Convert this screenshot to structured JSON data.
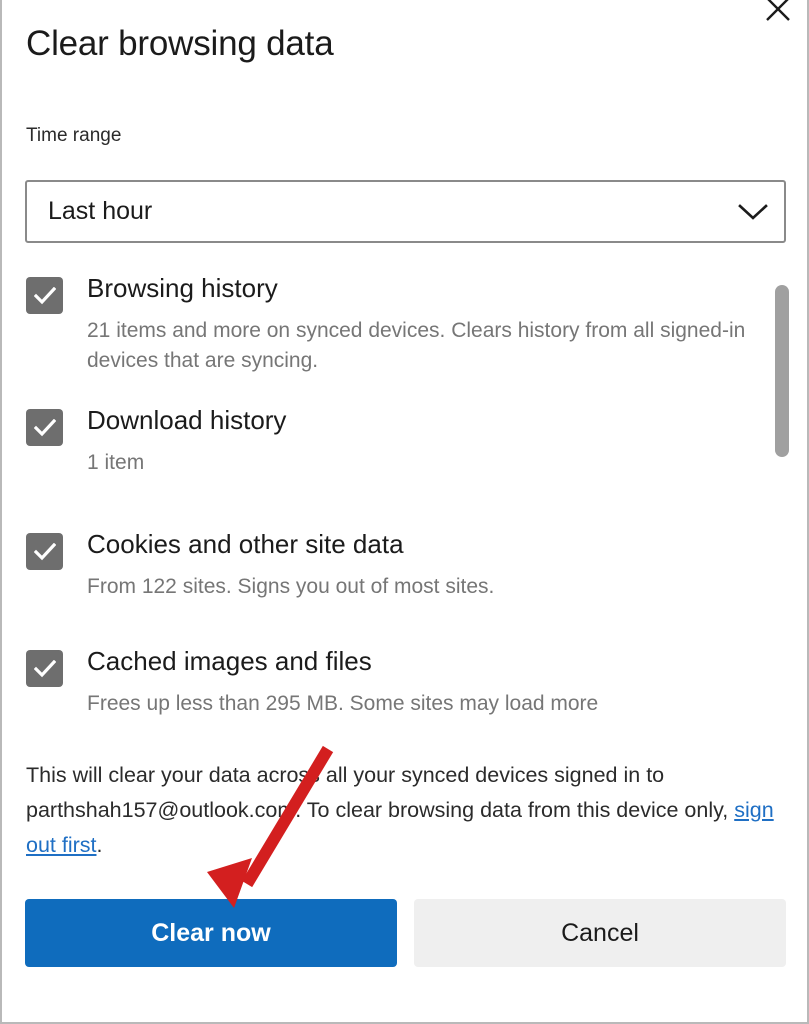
{
  "dialog": {
    "title": "Clear browsing data",
    "close_icon": "close-icon"
  },
  "time_range": {
    "label": "Time range",
    "selected": "Last hour",
    "chevron_icon": "chevron-down-icon"
  },
  "options": [
    {
      "id": "browsing-history",
      "label": "Browsing history",
      "description": "21 items and more on synced devices. Clears history from all signed-in devices that are syncing.",
      "checked": true
    },
    {
      "id": "download-history",
      "label": "Download history",
      "description": "1 item",
      "checked": true
    },
    {
      "id": "cookies-and-other-site-data",
      "label": "Cookies and other site data",
      "description": "From 122 sites. Signs you out of most sites.",
      "checked": true
    },
    {
      "id": "cached-images-and-files",
      "label": "Cached images and files",
      "description": "Frees up less than 295 MB. Some sites may load more",
      "checked": true
    }
  ],
  "footer": {
    "text_before_link": "This will clear your data across all your synced devices signed in to parthshah157@outlook.com. To clear browsing data from this device only, ",
    "link_text": "sign out first",
    "text_after_link": ".",
    "account_email": "parthshah157@outlook.com"
  },
  "actions": {
    "primary_label": "Clear now",
    "secondary_label": "Cancel"
  },
  "colors": {
    "primary_button": "#0f6cbd",
    "secondary_button": "#efefef",
    "checkbox": "#6e6e6e",
    "link": "#1f6fc4",
    "annotation_arrow": "#d31f1f",
    "scrollbar_thumb": "#a0a0a0"
  },
  "annotation": {
    "type": "arrow",
    "points_to": "Clear now",
    "color": "#d31f1f"
  }
}
